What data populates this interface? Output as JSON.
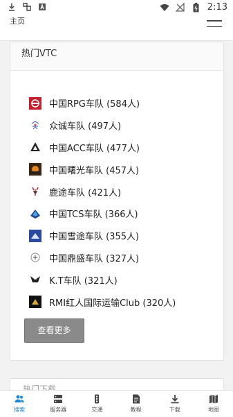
{
  "status_bar": {
    "time": "2:13"
  },
  "header": {
    "home_label": "主页"
  },
  "section": {
    "title": "热门VTC",
    "items": [
      {
        "name": "中国RPG车队 (584人)"
      },
      {
        "name": "众诚车队 (497人)"
      },
      {
        "name": "中国ACC车队 (477人)"
      },
      {
        "name": "中国曙光车队 (457人)"
      },
      {
        "name": "鹿途车队 (421人)"
      },
      {
        "name": "中国TCS车队 (366人)"
      },
      {
        "name": "中国雪途车队 (355人)"
      },
      {
        "name": "中国鼎盛车队 (327人)"
      },
      {
        "name": "K.T车队 (321人)"
      },
      {
        "name": "RMI红人国际运输Club (320人)"
      }
    ],
    "more_button": "查看更多"
  },
  "next_section": {
    "title": "热门下载"
  },
  "bottom_nav": {
    "items": [
      {
        "label": "搜索",
        "icon": "people-icon"
      },
      {
        "label": "服务器",
        "icon": "server-icon"
      },
      {
        "label": "交通",
        "icon": "traffic-light-icon"
      },
      {
        "label": "教程",
        "icon": "document-icon"
      },
      {
        "label": "下载",
        "icon": "download-icon"
      },
      {
        "label": "地图",
        "icon": "map-icon"
      }
    ]
  },
  "colors": {
    "accent": "#1a88d6",
    "button_gray": "#8a8a8a"
  }
}
